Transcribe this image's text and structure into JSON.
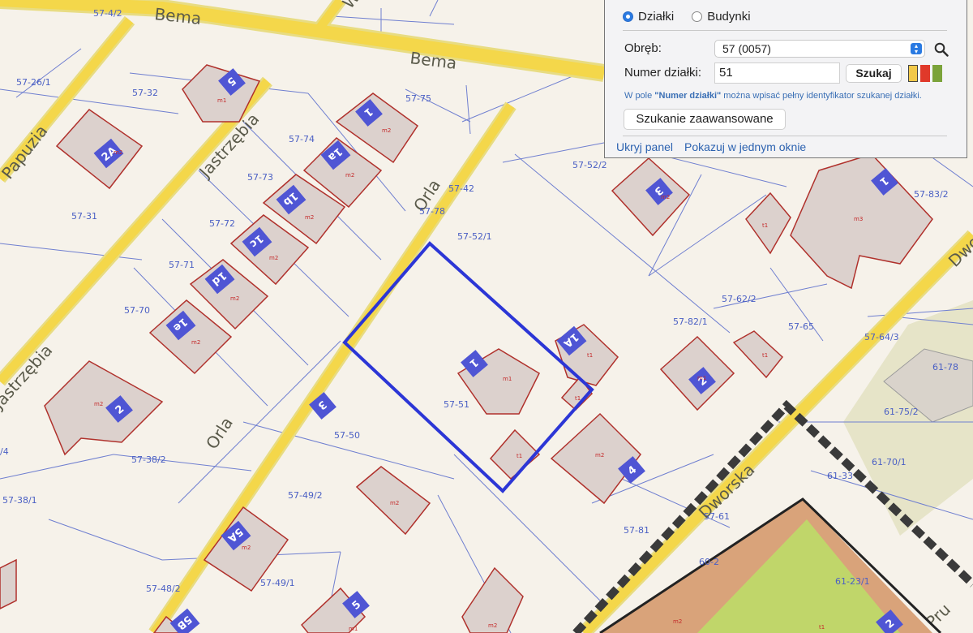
{
  "streets": [
    "Bema",
    "Bema",
    "Papuzia",
    "Jastrzębia",
    "Orla",
    "Orla",
    "Jastrzębia",
    "Dworska",
    "Dwo",
    "Pru",
    "Wr"
  ],
  "parcel_labels": [
    "57-4/2",
    "57-26/1",
    "57-32",
    "57-75",
    "57-74",
    "57-73",
    "57-72",
    "57-71",
    "57-70",
    "57-31",
    "57-42",
    "57-78",
    "57-52/1",
    "57-52/2",
    "57-83/2",
    "57-62/2",
    "57-65",
    "57-82/1",
    "57-64/3",
    "61-78",
    "61-75/2",
    "57-51",
    "57-50",
    "57-38/2",
    "57-38/1",
    "57-49/2",
    "57-49/1",
    "57-48/2",
    "57-81",
    "57-61",
    "60-2",
    "61-33",
    "61-70/1",
    "61-23/1",
    "/4"
  ],
  "house_numbers": [
    "5",
    "2A",
    "1",
    "1a",
    "1b",
    "1c",
    "1d",
    "1e",
    "2",
    "3",
    "1",
    "1A",
    "3",
    "1",
    "2",
    "4",
    "5A",
    "5",
    "5B",
    "2"
  ],
  "building_labels": [
    "m1",
    "m2",
    "m2",
    "m2",
    "m2",
    "m2",
    "m2",
    "m2",
    "m2",
    "m1",
    "t1",
    "t1",
    "m2",
    "m3",
    "t1",
    "t1",
    "m1",
    "m2",
    "m2",
    "m2",
    "m1",
    "m2",
    "t1",
    "t1",
    "m2"
  ],
  "panel": {
    "radio_dzialki": "Działki",
    "radio_budynki": "Budynki",
    "obreb_label": "Obręb:",
    "obreb_value": "57 (0057)",
    "numer_label": "Numer działki:",
    "numer_value": "51",
    "szukaj_label": "Szukaj",
    "hint_prefix": "W pole ",
    "hint_bold": "\"Numer działki\"",
    "hint_suffix": " można wpisać pełny identyfikator szukanej działki.",
    "advanced_label": "Szukanie zaawansowane",
    "hide_label": "Ukryj panel",
    "show_single_label": "Pokazuj w jednym oknie",
    "swatch_colors": [
      "#f2c94a",
      "#e0392a",
      "#7ba33a"
    ]
  }
}
